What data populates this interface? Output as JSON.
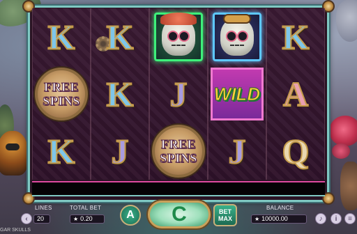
{
  "reels": [
    [
      "K",
      "FREE SPINS",
      "K"
    ],
    [
      "K",
      "K",
      "J"
    ],
    [
      "skull-green",
      "J",
      "FREE SPINS"
    ],
    [
      "skull-blue",
      "WILD",
      "J"
    ],
    [
      "K",
      "A",
      "Q"
    ]
  ],
  "symbols": {
    "free_spins_line1": "FREE",
    "free_spins_line2": "SPINS",
    "wild": "WILD",
    "k": "K",
    "j": "J",
    "a": "A",
    "q": "Q"
  },
  "controls": {
    "lines_label": "LINES",
    "lines_value": "20",
    "total_bet_label": "TOTAL BET",
    "total_bet_value": "0.20",
    "balance_label": "BALANCE",
    "balance_value": "10000.00",
    "auto_label": "A",
    "spin_label": "C",
    "bet_max_line1": "BET",
    "bet_max_line2": "MAX",
    "game_name": "GAR SKULLS",
    "currency_icon": "★"
  },
  "colors": {
    "frame_border": "#7fc9c3",
    "message_bar_border": "#e04aa0",
    "spin_button": "#9fe0bc",
    "wild_background": "#c23ab0"
  }
}
